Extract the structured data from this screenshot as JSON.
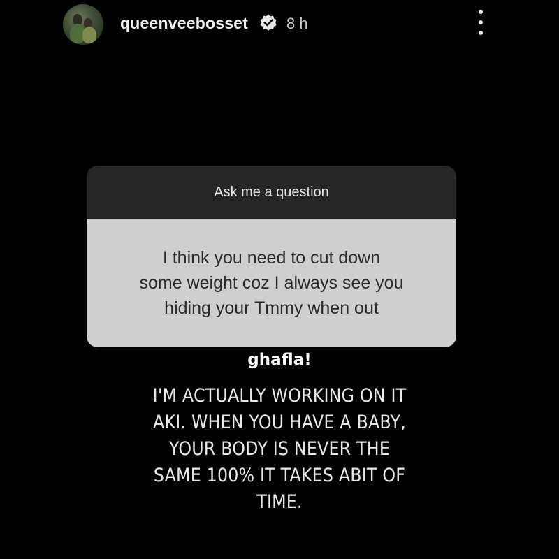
{
  "header": {
    "username": "queenveebosset",
    "verified_icon": "verified-badge-icon",
    "time_ago": "8 h",
    "more_icon": "more-vertical-icon"
  },
  "question_card": {
    "prompt": "Ask me a question",
    "question_lines": [
      "I think you need to cut down",
      "some weight coz I always see you",
      "hiding your Tmmy when out"
    ]
  },
  "watermark": "ghafla!",
  "answer_lines": [
    "I'M ACTUALLY WORKING ON IT",
    "AKI. WHEN YOU HAVE A BABY,",
    "YOUR BODY IS NEVER THE",
    "SAME 100% IT TAKES ABIT OF",
    "TIME."
  ],
  "colors": {
    "background": "#000000",
    "card_header": "#262626",
    "card_body": "#cfcfcf"
  }
}
